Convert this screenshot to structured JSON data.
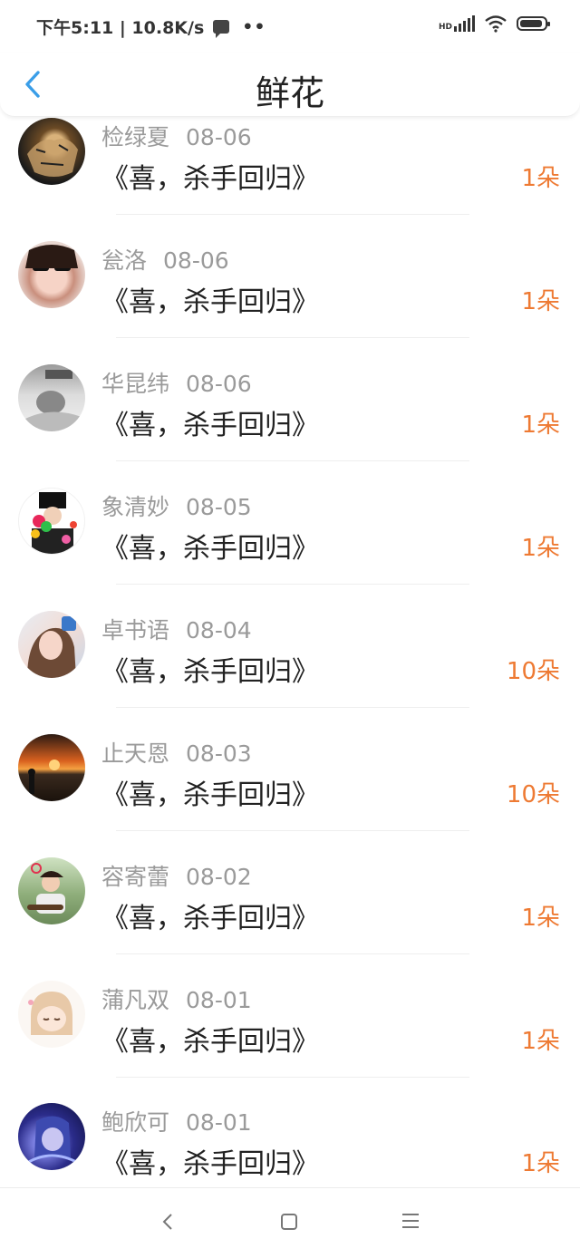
{
  "status_bar": {
    "time_speed": "下午5:11 | 10.8K/s",
    "dots": "••",
    "signal_label": "HD"
  },
  "header": {
    "title": "鲜花",
    "back_icon": "chevron-left-icon",
    "accent_color": "#3a9ee8"
  },
  "list": {
    "items": [
      {
        "name": "检绿夏",
        "date": "08-06",
        "book": "《喜，杀手回归》",
        "count": "1朵",
        "avatar": "tiger"
      },
      {
        "name": "瓮洛",
        "date": "08-06",
        "book": "《喜，杀手回归》",
        "count": "1朵",
        "avatar": "girl-sunglasses"
      },
      {
        "name": "华昆纬",
        "date": "08-06",
        "book": "《喜，杀手回归》",
        "count": "1朵",
        "avatar": "boy-bw"
      },
      {
        "name": "象清妙",
        "date": "08-05",
        "book": "《喜，杀手回归》",
        "count": "1朵",
        "avatar": "cartoon-flowers"
      },
      {
        "name": "卓书语",
        "date": "08-04",
        "book": "《喜，杀手回归》",
        "count": "10朵",
        "avatar": "girl-portrait"
      },
      {
        "name": "止天恩",
        "date": "08-03",
        "book": "《喜，杀手回归》",
        "count": "10朵",
        "avatar": "sunset"
      },
      {
        "name": "容寄蕾",
        "date": "08-02",
        "book": "《喜，杀手回归》",
        "count": "1朵",
        "avatar": "boy-guitar"
      },
      {
        "name": "蒲凡双",
        "date": "08-01",
        "book": "《喜，杀手回归》",
        "count": "1朵",
        "avatar": "anime-girl"
      },
      {
        "name": "鲍欣可",
        "date": "08-01",
        "book": "《喜，杀手回归》",
        "count": "1朵",
        "avatar": "anime-blue"
      }
    ],
    "count_color": "#ee7a33"
  },
  "nav_bar": {
    "back_icon": "nav-back-icon",
    "home_icon": "nav-home-icon",
    "menu_icon": "nav-menu-icon"
  }
}
